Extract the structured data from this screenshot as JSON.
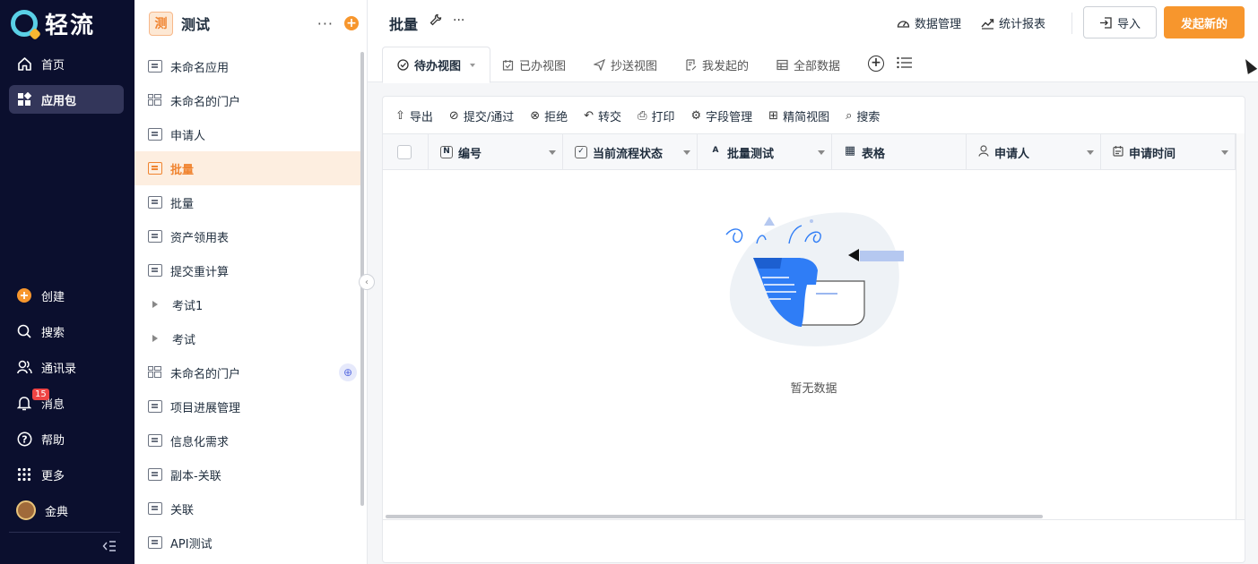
{
  "nav": {
    "logo_text": "轻流",
    "items": [
      {
        "label": "首页",
        "icon": "home-icon"
      },
      {
        "label": "应用包",
        "icon": "apps-icon"
      },
      {
        "label": "创建",
        "icon": "plus-circle-icon"
      },
      {
        "label": "搜索",
        "icon": "search-icon"
      },
      {
        "label": "通讯录",
        "icon": "contacts-icon"
      },
      {
        "label": "消息",
        "icon": "bell-icon",
        "badge": "15"
      },
      {
        "label": "帮助",
        "icon": "help-icon"
      },
      {
        "label": "更多",
        "icon": "grid-icon"
      },
      {
        "label": "金典",
        "icon": "avatar"
      }
    ],
    "collapse_icon": "collapse-icon"
  },
  "sidebar": {
    "app_icon_text": "测",
    "title": "测试",
    "items": [
      {
        "label": "未命名应用",
        "type": "form"
      },
      {
        "label": "未命名的门户",
        "type": "portal"
      },
      {
        "label": "申请人",
        "type": "form"
      },
      {
        "label": "批量",
        "type": "form",
        "active": true
      },
      {
        "label": "批量",
        "type": "form"
      },
      {
        "label": "资产领用表",
        "type": "form"
      },
      {
        "label": "提交重计算",
        "type": "form"
      },
      {
        "label": "考试1",
        "type": "group"
      },
      {
        "label": "考试",
        "type": "group"
      },
      {
        "label": "未命名的门户",
        "type": "portal",
        "globe": true
      },
      {
        "label": "项目进展管理",
        "type": "form"
      },
      {
        "label": "信息化需求",
        "type": "form"
      },
      {
        "label": "副本-关联",
        "type": "form"
      },
      {
        "label": "关联",
        "type": "form"
      },
      {
        "label": "API测试",
        "type": "form"
      }
    ]
  },
  "header": {
    "title": "批量",
    "data_manage": "数据管理",
    "stats_report": "统计报表",
    "import_label": "导入",
    "new_label": "发起新的"
  },
  "tabs": [
    {
      "label": "待办视图"
    },
    {
      "label": "已办视图"
    },
    {
      "label": "抄送视图"
    },
    {
      "label": "我发起的"
    },
    {
      "label": "全部数据"
    }
  ],
  "toolbar": {
    "export": "导出",
    "submit": "提交/通过",
    "reject": "拒绝",
    "transfer": "转交",
    "print": "打印",
    "fields": "字段管理",
    "compact": "精简视图",
    "search": "搜索"
  },
  "table": {
    "columns": [
      {
        "label": "编号",
        "icon": "N"
      },
      {
        "label": "当前流程状态",
        "icon": "✓"
      },
      {
        "label": "批量测试",
        "icon": "A"
      },
      {
        "label": "表格",
        "icon": "▦"
      },
      {
        "label": "申请人",
        "icon": "person"
      },
      {
        "label": "申请时间",
        "icon": "calendar"
      }
    ],
    "empty_text": "暂无数据"
  },
  "colors": {
    "nav_bg": "#0b0f2e",
    "accent": "#f7962d",
    "active_bg": "#fdeee0",
    "illustration_blue": "#2f7df6"
  }
}
